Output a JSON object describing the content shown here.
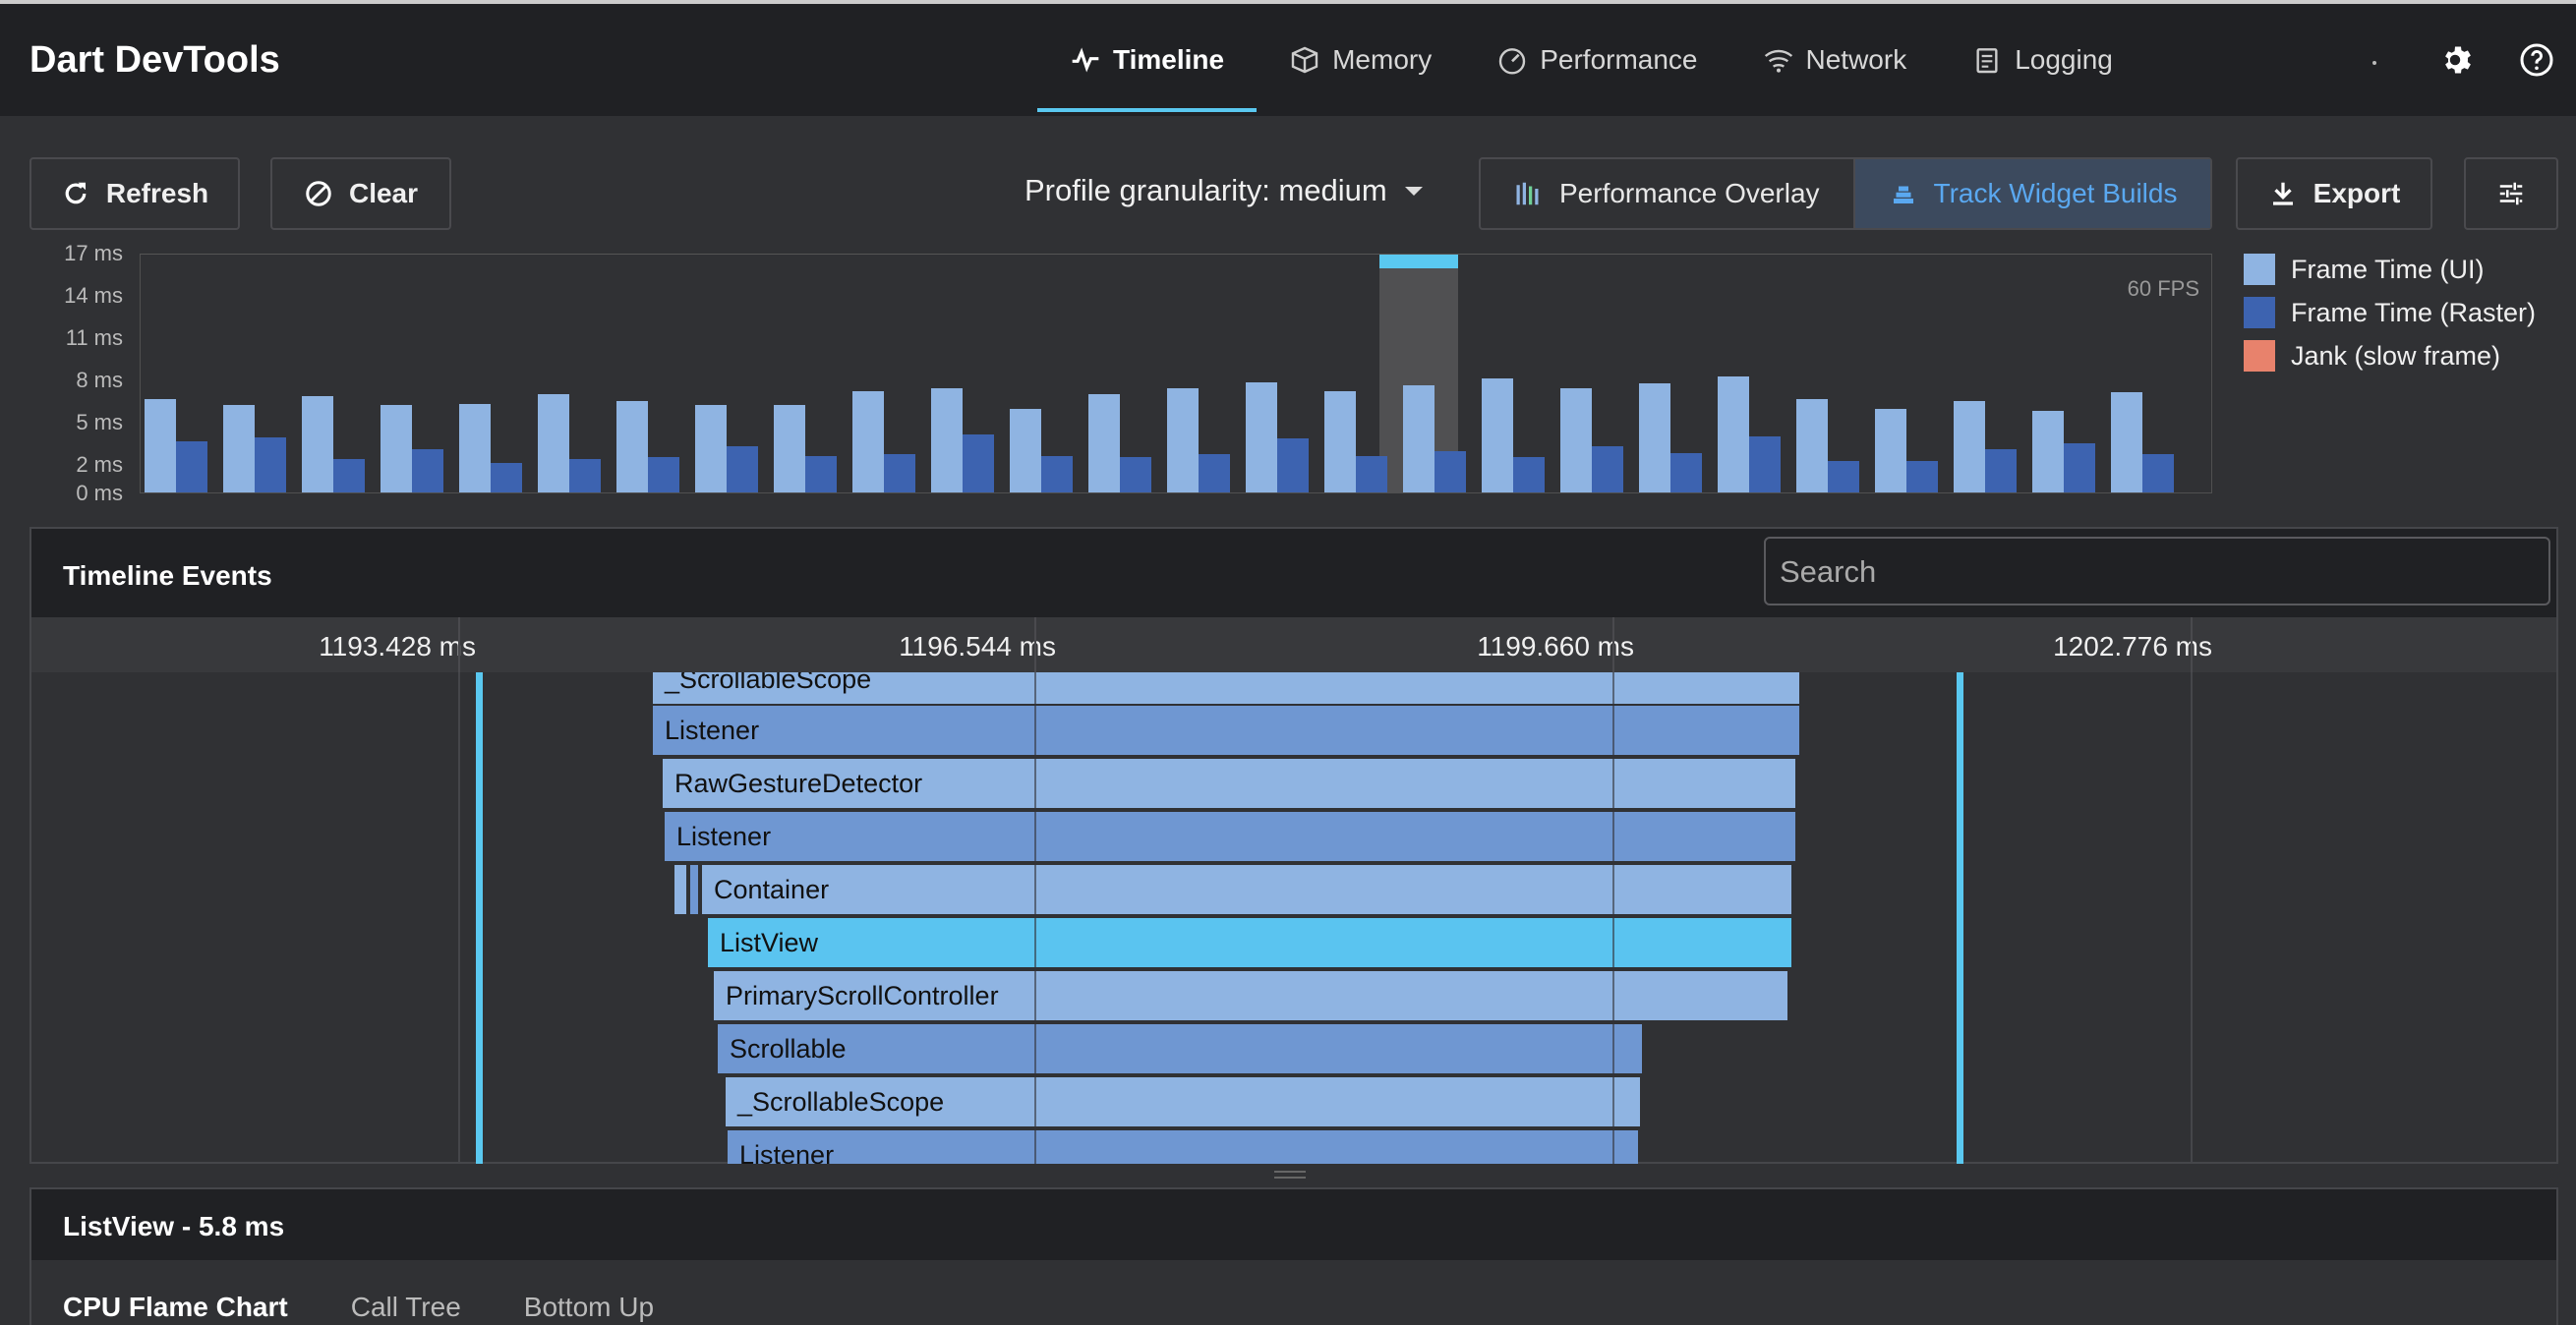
{
  "app": {
    "title": "Dart DevTools"
  },
  "nav": {
    "tabs": [
      {
        "label": "Timeline",
        "icon": "timeline-icon",
        "active": true
      },
      {
        "label": "Memory",
        "icon": "memory-icon",
        "active": false
      },
      {
        "label": "Performance",
        "icon": "performance-icon",
        "active": false
      },
      {
        "label": "Network",
        "icon": "network-icon",
        "active": false
      },
      {
        "label": "Logging",
        "icon": "logging-icon",
        "active": false
      }
    ]
  },
  "toolbar": {
    "refresh_label": "Refresh",
    "clear_label": "Clear",
    "granularity_label": "Profile granularity: medium",
    "performance_overlay_label": "Performance Overlay",
    "track_widget_builds_label": "Track Widget Builds",
    "export_label": "Export"
  },
  "colors": {
    "accent": "#5ac8f0",
    "frame_ui": "#8fb4e2",
    "frame_raster": "#3d63b0",
    "jank": "#e8826c"
  },
  "chart_data": {
    "type": "bar",
    "title": "",
    "ylabel": "",
    "yticks": [
      "17 ms",
      "14 ms",
      "11 ms",
      "8 ms",
      "5 ms",
      "2 ms",
      "0 ms"
    ],
    "ylim": [
      0,
      17
    ],
    "annotation": "60 FPS",
    "selected_frame": 16,
    "series": [
      {
        "name": "Frame Time (UI)",
        "values": [
          6.6,
          6.2,
          6.8,
          6.2,
          6.3,
          7.0,
          6.5,
          6.2,
          6.2,
          7.2,
          7.4,
          5.9,
          7.0,
          7.4,
          7.8,
          7.2,
          7.6,
          8.1,
          7.4,
          7.7,
          8.2,
          6.6,
          5.9,
          6.5,
          5.8,
          7.1
        ]
      },
      {
        "name": "Frame Time (Raster)",
        "values": [
          3.6,
          3.9,
          2.4,
          3.1,
          2.1,
          2.4,
          2.5,
          3.3,
          2.6,
          2.7,
          4.1,
          2.6,
          2.5,
          2.7,
          3.8,
          2.6,
          2.9,
          2.5,
          3.3,
          2.8,
          4.0,
          2.2,
          2.2,
          3.1,
          3.5,
          2.7
        ]
      }
    ],
    "legend": [
      "Frame Time (UI)",
      "Frame Time (Raster)",
      "Jank (slow frame)"
    ],
    "legend_position": "right"
  },
  "events": {
    "title": "Timeline Events",
    "search_placeholder": "Search",
    "ticks": [
      "1193.428 ms",
      "1196.544 ms",
      "1199.660 ms",
      "1202.776 ms"
    ],
    "bars": [
      {
        "label": "_ScrollableScope",
        "tone": "light"
      },
      {
        "label": "Listener",
        "tone": "mid"
      },
      {
        "label": "RawGestureDetector",
        "tone": "light"
      },
      {
        "label": "Listener",
        "tone": "mid"
      },
      {
        "label": "Container",
        "tone": "light"
      },
      {
        "label": "ListView",
        "tone": "sel"
      },
      {
        "label": "PrimaryScrollController",
        "tone": "light"
      },
      {
        "label": "Scrollable",
        "tone": "mid"
      },
      {
        "label": "_ScrollableScope",
        "tone": "light"
      },
      {
        "label": "Listener",
        "tone": "mid"
      }
    ]
  },
  "details": {
    "title": "ListView - 5.8 ms",
    "tabs": [
      "CPU Flame Chart",
      "Call Tree",
      "Bottom Up"
    ]
  }
}
